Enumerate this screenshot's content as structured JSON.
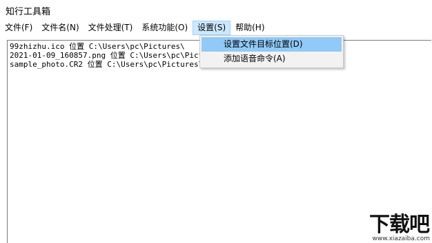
{
  "window": {
    "title": "知行工具箱"
  },
  "menubar": {
    "items": [
      {
        "label": "文件(F)"
      },
      {
        "label": "文件名(N)"
      },
      {
        "label": "文件处理(T)"
      },
      {
        "label": "系统功能(O)"
      },
      {
        "label": "设置(S)"
      },
      {
        "label": "帮助(H)"
      }
    ],
    "active_index": 4
  },
  "content": {
    "lines": [
      "99zhizhu.ico 位置 C:\\Users\\pc\\Pictures\\",
      "2021-01-09_160857.png 位置 C:\\Users\\pc\\Pictures\\",
      "sample_photo.CR2 位置 C:\\Users\\pc\\Pictures\\"
    ]
  },
  "settings_menu": {
    "items": [
      {
        "label": "设置文件目标位置(D)"
      },
      {
        "label": "添加语音命令(A)"
      }
    ],
    "hover_index": 0
  },
  "watermark": {
    "brand": "下载吧",
    "url": "www.xiazaiba.com"
  },
  "colors": {
    "menu_active_bg": "#cce8ff",
    "menu_active_border": "#99d1ff",
    "dropdown_bg": "#f2f2f2",
    "dropdown_hover": "#91c9f7"
  }
}
